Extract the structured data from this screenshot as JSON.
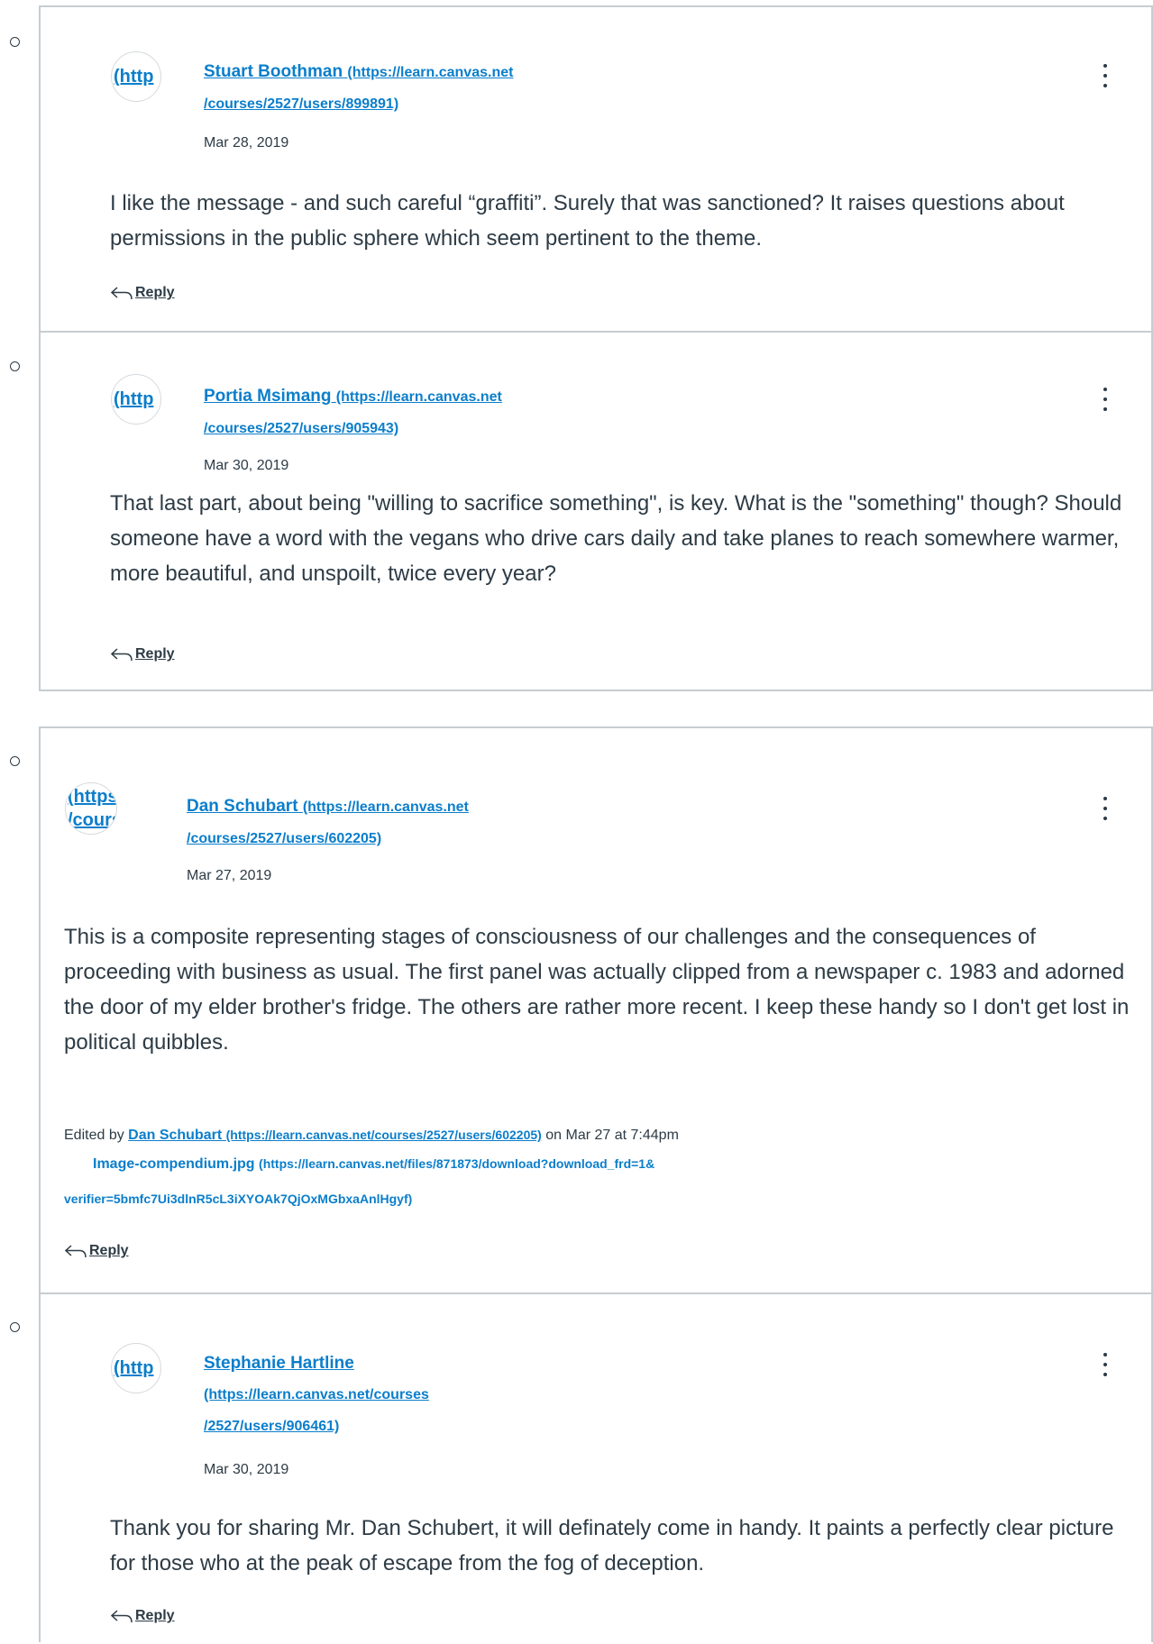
{
  "threads": [
    {
      "entries": [
        {
          "avatar_alt": "(http",
          "author_name": "Stuart Boothman",
          "author_url_line1": "(https://learn.canvas.net",
          "author_url_line2": "/courses/2527/users/899891)",
          "date": "Mar 28, 2019",
          "message": "I like the message - and such careful “graffiti”.  Surely that was sanctioned?  It raises questions about permissions in the public sphere which seem pertinent to the theme.",
          "reply_label": "Reply"
        },
        {
          "avatar_alt": "(http",
          "author_name": "Portia Msimang",
          "author_url_line1": "(https://learn.canvas.net",
          "author_url_line2": "/courses/2527/users/905943)",
          "date": "Mar 30, 2019",
          "message": "That last part, about being \"willing to sacrifice something\", is key. What is the \"something\" though? Should someone have a word with the vegans who drive cars daily and take planes to reach somewhere warmer, more beautiful, and unspoilt, twice every year?",
          "reply_label": "Reply"
        }
      ]
    },
    {
      "entries": [
        {
          "avatar_alt_line1": "(https:/",
          "avatar_alt_line2": "/course",
          "author_name": "Dan Schubart",
          "author_url_line1": "(https://learn.canvas.net",
          "author_url_line2": "/courses/2527/users/602205)",
          "date": "Mar 27, 2019",
          "message": "This is a composite representing stages of consciousness of our challenges and the consequences of proceeding with business as usual. The first panel was actually clipped from a newspaper c. 1983 and adorned the door of my elder brother's fridge. The others are rather more recent. I keep these handy so I don't get lost in political quibbles.",
          "edited_prefix": "Edited by ",
          "edited_name": "Dan Schubart",
          "edited_url": "(https://learn.canvas.net/courses/2527/users/602205)",
          "edited_suffix": " on Mar 27 at 7:44pm",
          "attachment_name": "Image-compendium.jpg",
          "attachment_url_line1": "(https://learn.canvas.net/files/871873/download?download_frd=1&",
          "attachment_url_line2": "verifier=5bmfc7Ui3dlnR5cL3iXYOAk7QjOxMGbxaAnlHgyf)",
          "reply_label": "Reply"
        },
        {
          "avatar_alt": "(http",
          "author_name": "Stephanie Hartline",
          "author_url_line1": "(https://learn.canvas.net/courses",
          "author_url_line2": "/2527/users/906461)",
          "date": "Mar 30, 2019",
          "message": "Thank you for sharing Mr. Dan Schubert, it will definately come in handy. It paints a perfectly clear picture for those who at the peak of escape from the fog of deception.",
          "reply_label": "Reply"
        }
      ]
    }
  ],
  "icons": {
    "bullet": "circle-outline-icon",
    "menu": "kebab-menu-icon",
    "reply": "reply-arrow-icon"
  },
  "colors": {
    "link": "#0b7ecb",
    "text": "#2d3b45",
    "border": "#c7cdd1"
  }
}
